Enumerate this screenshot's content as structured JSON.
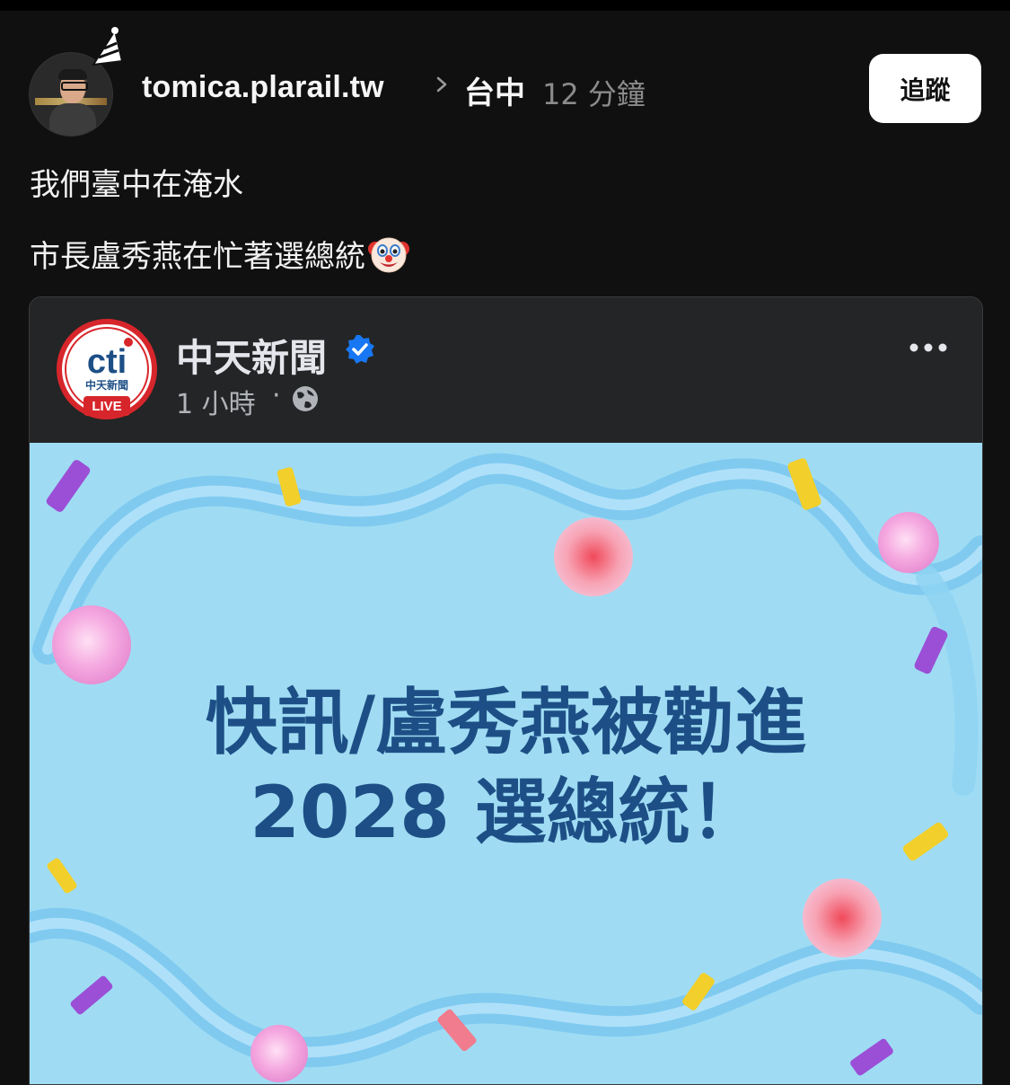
{
  "post": {
    "username": "tomica.plarail.tw",
    "location": "台中",
    "time_ago": "12 分鐘",
    "follow_label": "追蹤",
    "text_line1": "我們臺中在淹水",
    "text_line2": "市長盧秀燕在忙著選總統"
  },
  "shared_card": {
    "page_name": "中天新聞",
    "logo_text": "cti",
    "logo_subtext": "中天新聞",
    "logo_badge": "LIVE",
    "time": "1 小時",
    "separator": "·",
    "headline_line1": "快訊/盧秀燕被勸進",
    "headline_line2": "2028 選總統！"
  },
  "colors": {
    "background": "#101010",
    "card_header": "#242526",
    "promo_bg": "#9fdcf3",
    "headline": "#1d4f86",
    "verified_blue": "#1877f2",
    "logo_red": "#d7262b"
  },
  "icons": [
    "party-hat-icon",
    "chevron-right-icon",
    "clown-emoji-icon",
    "verified-badge-icon",
    "globe-icon",
    "more-options-icon"
  ]
}
